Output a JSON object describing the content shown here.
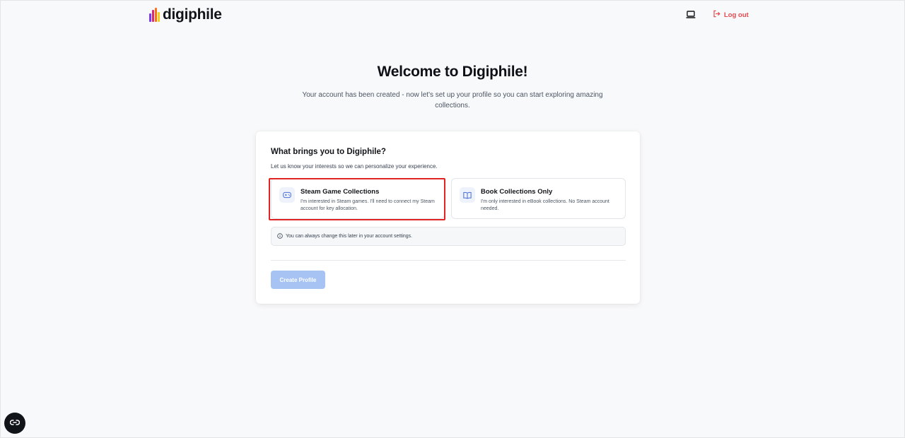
{
  "header": {
    "brand": "digiphile",
    "logout_label": "Log out",
    "icons": {
      "device": "laptop-icon",
      "logout": "logout-icon"
    }
  },
  "hero": {
    "title": "Welcome to Digiphile!",
    "subtitle": "Your account has been created - now let's set up your profile so you can start exploring amazing collections."
  },
  "card": {
    "title": "What brings you to Digiphile?",
    "subtitle": "Let us know your interests so we can personalize your experience.",
    "options": [
      {
        "title": "Steam Game Collections",
        "description": "I'm interested in Steam games. I'll need to connect my Steam account for key allocation.",
        "icon": "gamepad-icon"
      },
      {
        "title": "Book Collections Only",
        "description": "I'm only interested in eBook collections. No Steam account needed.",
        "icon": "book-icon"
      }
    ],
    "note": "You can always change this later in your account settings.",
    "submit_label": "Create Profile"
  },
  "colors": {
    "accent": "#3b82f6",
    "logout": "#e5484d",
    "button_disabled": "#a6c3f3",
    "highlight": "#e02424"
  },
  "floating_button": {
    "icon": "link-icon"
  }
}
